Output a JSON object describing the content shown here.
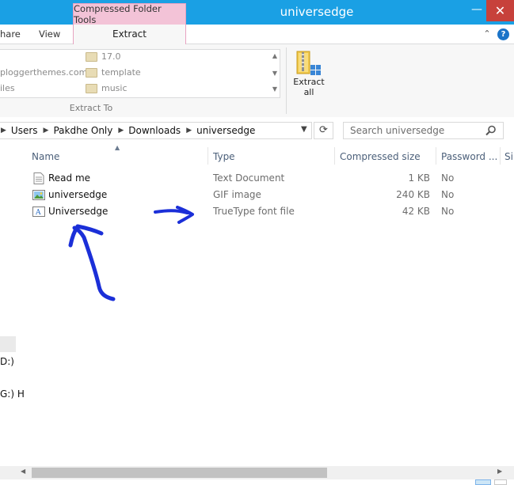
{
  "window": {
    "title": "universedge",
    "context_tab": "Compressed Folder Tools",
    "minimize": "—",
    "close": "✕"
  },
  "ribbon": {
    "tabs": [
      {
        "label": "hare"
      },
      {
        "label": "View"
      },
      {
        "label": "Extract"
      }
    ],
    "extract_to_items": [
      {
        "left": "",
        "right": "17.0"
      },
      {
        "left": "ploggerthemes.com)",
        "right": "template"
      },
      {
        "left": "iles",
        "right": "music"
      }
    ],
    "group_label": "Extract To",
    "extract_all": {
      "label_line1": "Extract",
      "label_line2": "all"
    }
  },
  "address": {
    "crumbs": [
      "Users",
      "Pakdhe Only",
      "Downloads",
      "universedge"
    ],
    "search_placeholder": "Search universedge"
  },
  "nav_pane": {
    "items": [
      "D:)",
      "G:) H"
    ]
  },
  "columns": [
    {
      "label": "Name"
    },
    {
      "label": "Type"
    },
    {
      "label": "Compressed size"
    },
    {
      "label": "Password ..."
    },
    {
      "label": "Si"
    }
  ],
  "files": [
    {
      "name": "Read me",
      "type": "Text Document",
      "size": "1 KB",
      "password": "No",
      "icon": "text-file-icon"
    },
    {
      "name": "universedge",
      "type": "GIF image",
      "size": "240 KB",
      "password": "No",
      "icon": "image-file-icon"
    },
    {
      "name": "Universedge",
      "type": "TrueType font file",
      "size": "42 KB",
      "password": "No",
      "icon": "font-file-icon"
    }
  ],
  "colors": {
    "title_bar": "#1aa0e4",
    "context_tab": "#f3c3d7",
    "close_button": "#c7413b",
    "annotation": "#1b2fd8"
  }
}
